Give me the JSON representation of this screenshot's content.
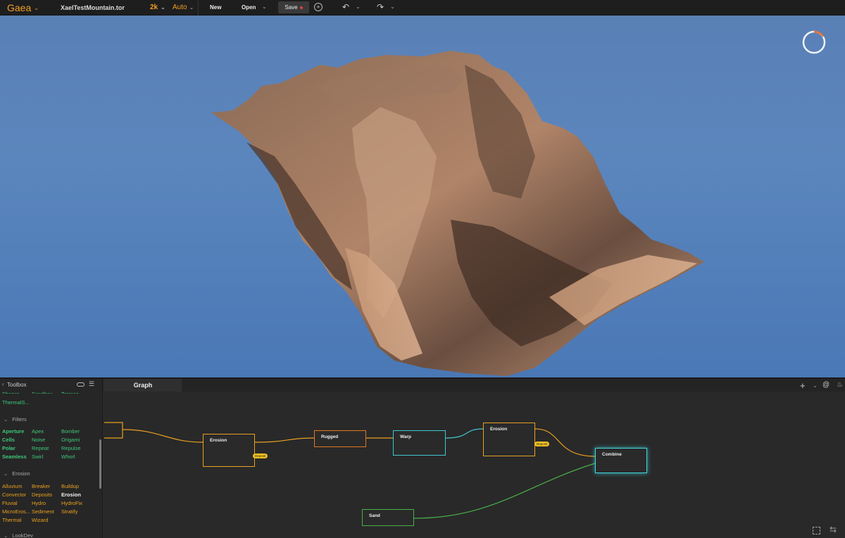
{
  "topbar": {
    "brand": "Gaea",
    "filename": "XaelTestMountain.tor",
    "resolution": "2k",
    "mode": "Auto",
    "new_label": "New",
    "open_label": "Open",
    "save_label": "Save"
  },
  "toolbox": {
    "title": "Toolbox",
    "top_partial": [
      "Shaper",
      "Sandbox",
      "Terrace"
    ],
    "top_item": "ThermalS...",
    "sections": [
      {
        "label": "Filters",
        "items": [
          [
            "Aperture",
            "Apex",
            "Bomber"
          ],
          [
            "Cells",
            "Noise",
            "Origami"
          ],
          [
            "Polar",
            "Repeat",
            "Repulse"
          ],
          [
            "Seamless",
            "Swirl",
            "Whorl"
          ]
        ]
      },
      {
        "label": "Erosion",
        "items": [
          [
            "Alluvium",
            "Breaker",
            "Buildup"
          ],
          [
            "Convector",
            "Deposits",
            "Erosion"
          ],
          [
            "Fluvial",
            "Hydro",
            "HydroFix"
          ],
          [
            "MicroEros...",
            "Sediment",
            "Stratify"
          ],
          [
            "Thermal",
            "Wizard",
            ""
          ]
        ]
      },
      {
        "label": "LookDev",
        "items": []
      }
    ]
  },
  "graph": {
    "tab": "Graph",
    "nodes": {
      "erosion1": "Erosion",
      "rugged": "Rugged",
      "warp": "Warp",
      "erosion2": "Erosion",
      "combine": "Combine",
      "sand": "Sand"
    },
    "deposit_label": "Deposit",
    "colors": {
      "orange": "#e8a020",
      "teal": "#3ec8d0",
      "green": "#4ab04a"
    }
  }
}
